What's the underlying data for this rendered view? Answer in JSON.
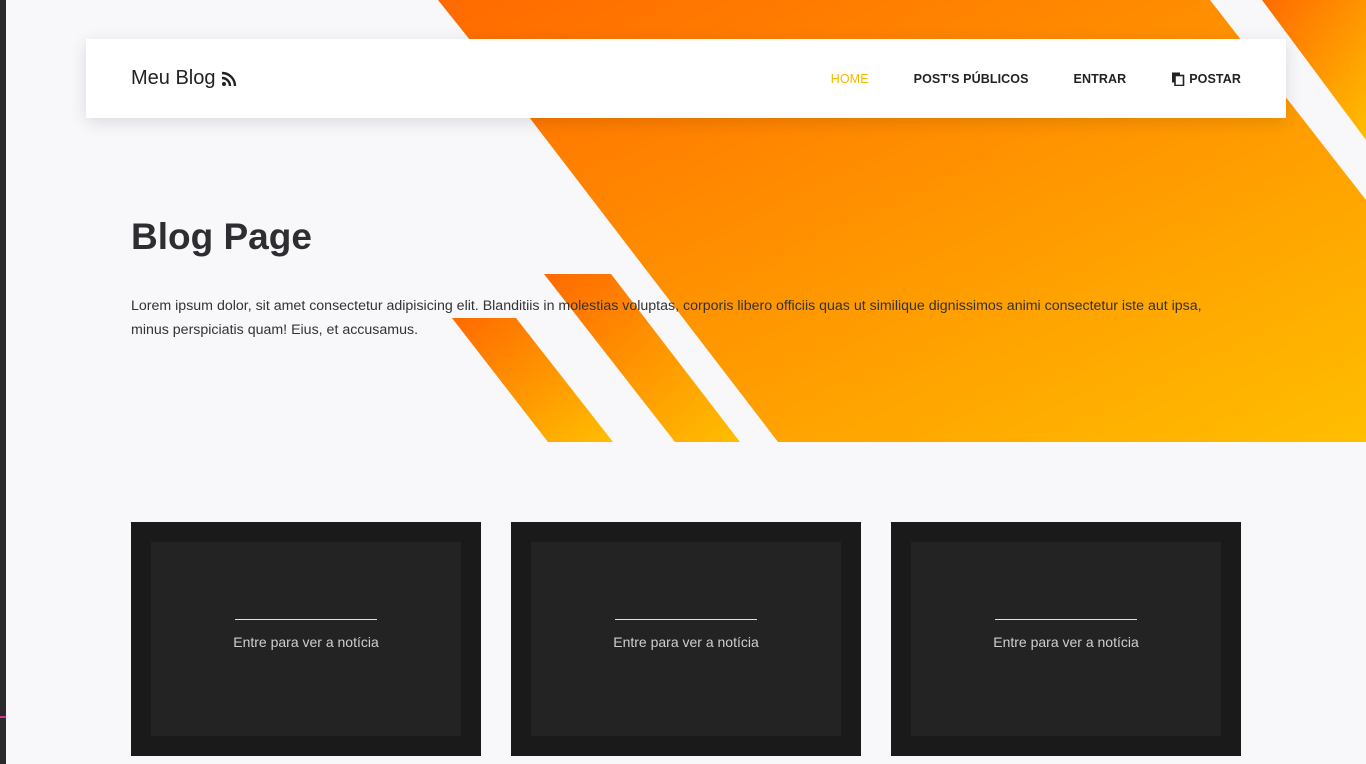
{
  "colors": {
    "accent": "#f5b800",
    "orange_dark": "#ff6a00",
    "orange_light": "#ffbe00",
    "page_bg": "#f8f8fb",
    "card_bg": "#1a1a1a"
  },
  "nav": {
    "brand": "Meu Blog",
    "brand_icon": "rss-icon",
    "links": [
      {
        "label": "HOME",
        "active": true
      },
      {
        "label": "POST'S PÚBLICOS",
        "active": false
      },
      {
        "label": "ENTRAR",
        "active": false
      },
      {
        "label": "POSTAR",
        "active": false,
        "icon": "copy-icon"
      }
    ]
  },
  "hero": {
    "title": "Blog Page",
    "text": "Lorem ipsum dolor, sit amet consectetur adipisicing elit. Blanditiis in molestias voluptas, corporis libero officiis quas ut similique dignissimos animi consectetur iste aut ipsa, minus perspiciatis quam! Eius, et accusamus."
  },
  "cards": [
    {
      "text": "Entre para ver a notícia"
    },
    {
      "text": "Entre para ver a notícia"
    },
    {
      "text": "Entre para ver a notícia"
    }
  ]
}
